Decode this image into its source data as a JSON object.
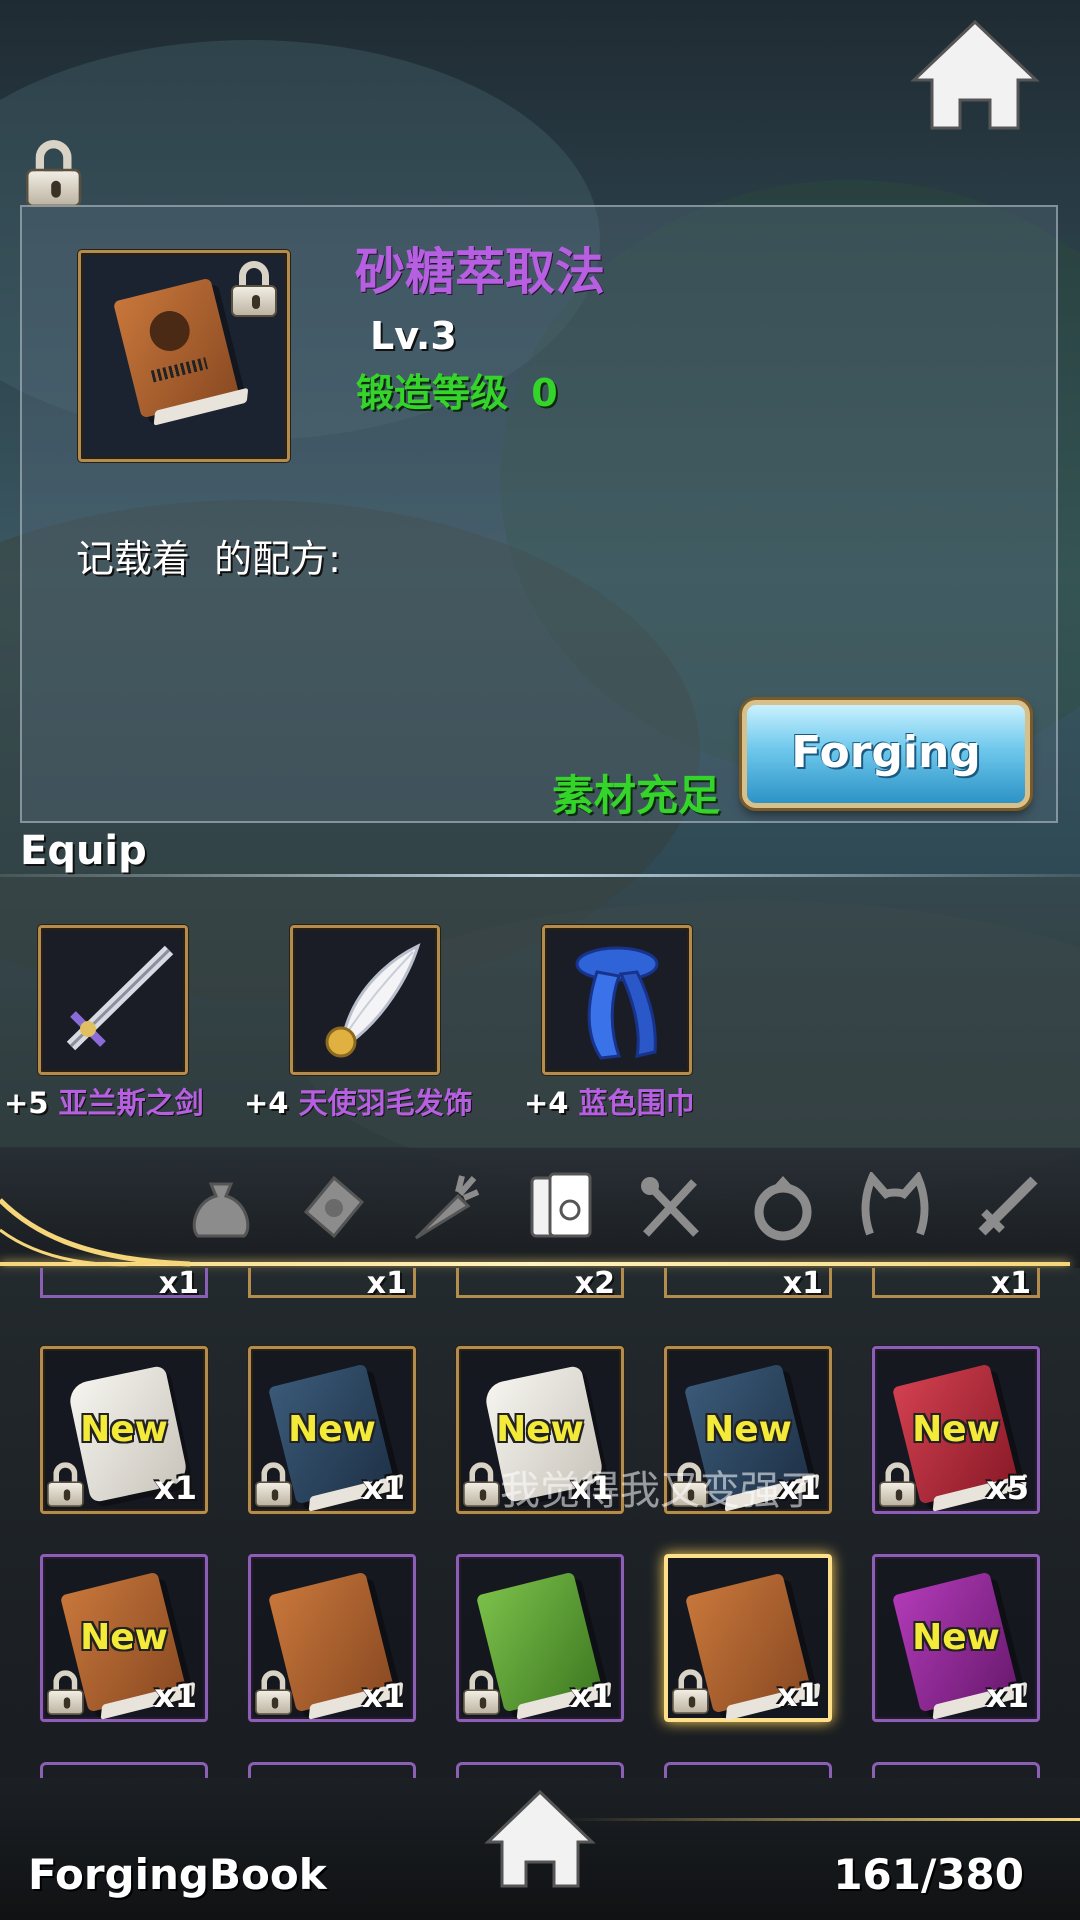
{
  "header": {
    "home_icon": "home-icon"
  },
  "detail": {
    "item_name": "砂糖萃取法",
    "level": "Lv.3",
    "forge_level_label": "锻造等级",
    "forge_level_value": "0",
    "description": "记载着  的配方:",
    "material_status": "素材充足",
    "forge_button": "Forging",
    "colors": {
      "name": "#b65fe0",
      "forge": "#35d42b"
    }
  },
  "equip": {
    "title": "Equip",
    "items": [
      {
        "plus": "+5",
        "name": "亚兰斯之剑",
        "icon": "sword-icon"
      },
      {
        "plus": "+4",
        "name": "天使羽毛发饰",
        "icon": "feather-hairpin-icon"
      },
      {
        "plus": "+4",
        "name": "蓝色围巾",
        "icon": "blue-scarf-icon"
      }
    ]
  },
  "tabs": [
    {
      "name": "bag-icon"
    },
    {
      "name": "envelope-icon"
    },
    {
      "name": "carrot-icon"
    },
    {
      "name": "book-icon",
      "active": true
    },
    {
      "name": "cutlery-icon"
    },
    {
      "name": "ring-icon"
    },
    {
      "name": "cat-ears-icon"
    },
    {
      "name": "sword-icon"
    }
  ],
  "inventory": {
    "top_partial_counts": [
      "x1",
      "x1",
      "x2",
      "x1",
      "x1"
    ],
    "row1": [
      {
        "kind": "scroll",
        "new": "New",
        "count": "x1"
      },
      {
        "kind": "blue-book",
        "new": "New",
        "count": "x1"
      },
      {
        "kind": "scroll",
        "new": "New",
        "count": "x1"
      },
      {
        "kind": "blue-book",
        "new": "New",
        "count": "x1"
      },
      {
        "kind": "red-book",
        "new": "New",
        "count": "x5"
      }
    ],
    "row2": [
      {
        "kind": "brown-book",
        "new": "New",
        "count": "x1"
      },
      {
        "kind": "brown-book",
        "new": "",
        "count": "x1"
      },
      {
        "kind": "green-book",
        "new": "",
        "count": "x1"
      },
      {
        "kind": "brown-book",
        "new": "",
        "count": "x1",
        "selected": true
      },
      {
        "kind": "purple-book",
        "new": "New",
        "count": "x1"
      }
    ],
    "toast": "我觉得我又变强了"
  },
  "footer": {
    "title": "ForgingBook",
    "count": "161/380"
  }
}
